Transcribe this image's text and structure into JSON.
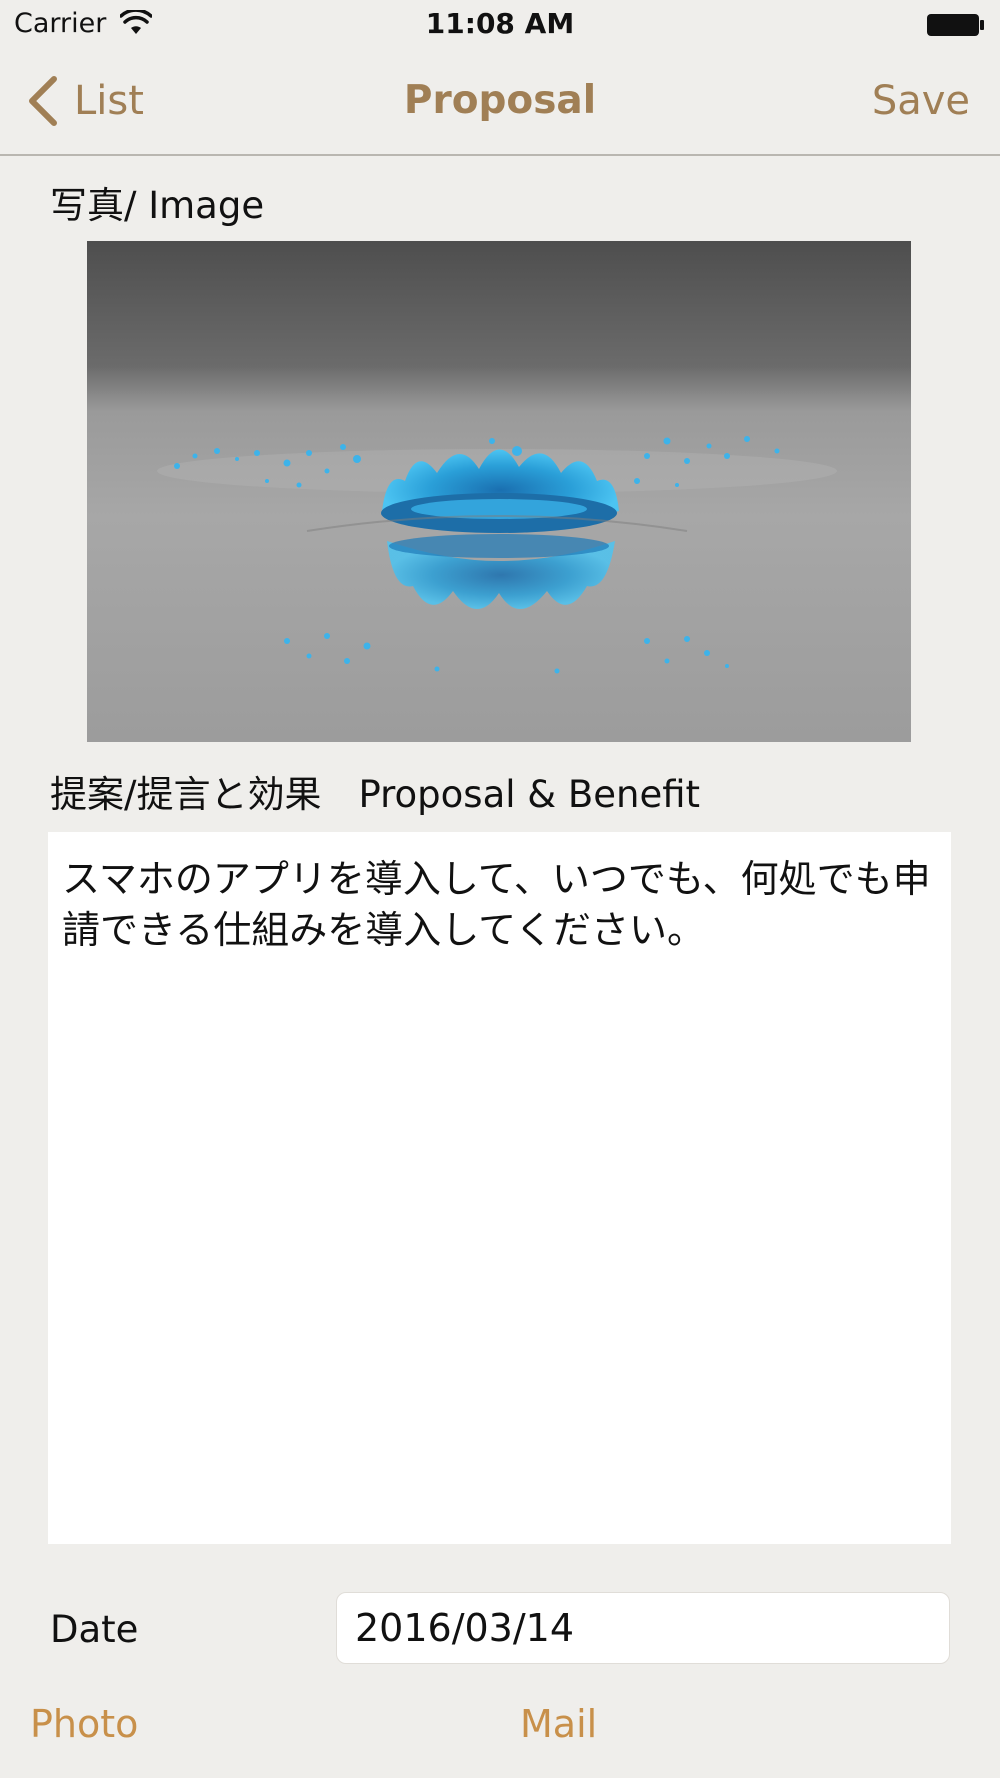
{
  "status_bar": {
    "carrier": "Carrier",
    "time": "11:08 AM"
  },
  "nav": {
    "back_label": "List",
    "title": "Proposal",
    "save_label": "Save"
  },
  "form": {
    "image_label": "写真/ Image",
    "proposal_label": "提案/提言と効果　Proposal & Benefit",
    "proposal_text": "スマホのアプリを導入して、いつでも、何処でも申請できる仕組みを導入してください。",
    "date_label": "Date",
    "date_value": "2016/03/14"
  },
  "toolbar": {
    "photo_label": "Photo",
    "mail_label": "Mail"
  },
  "colors": {
    "accent": "#a07f55",
    "toolbar_accent": "#c8904a",
    "background": "#efeeeb"
  }
}
